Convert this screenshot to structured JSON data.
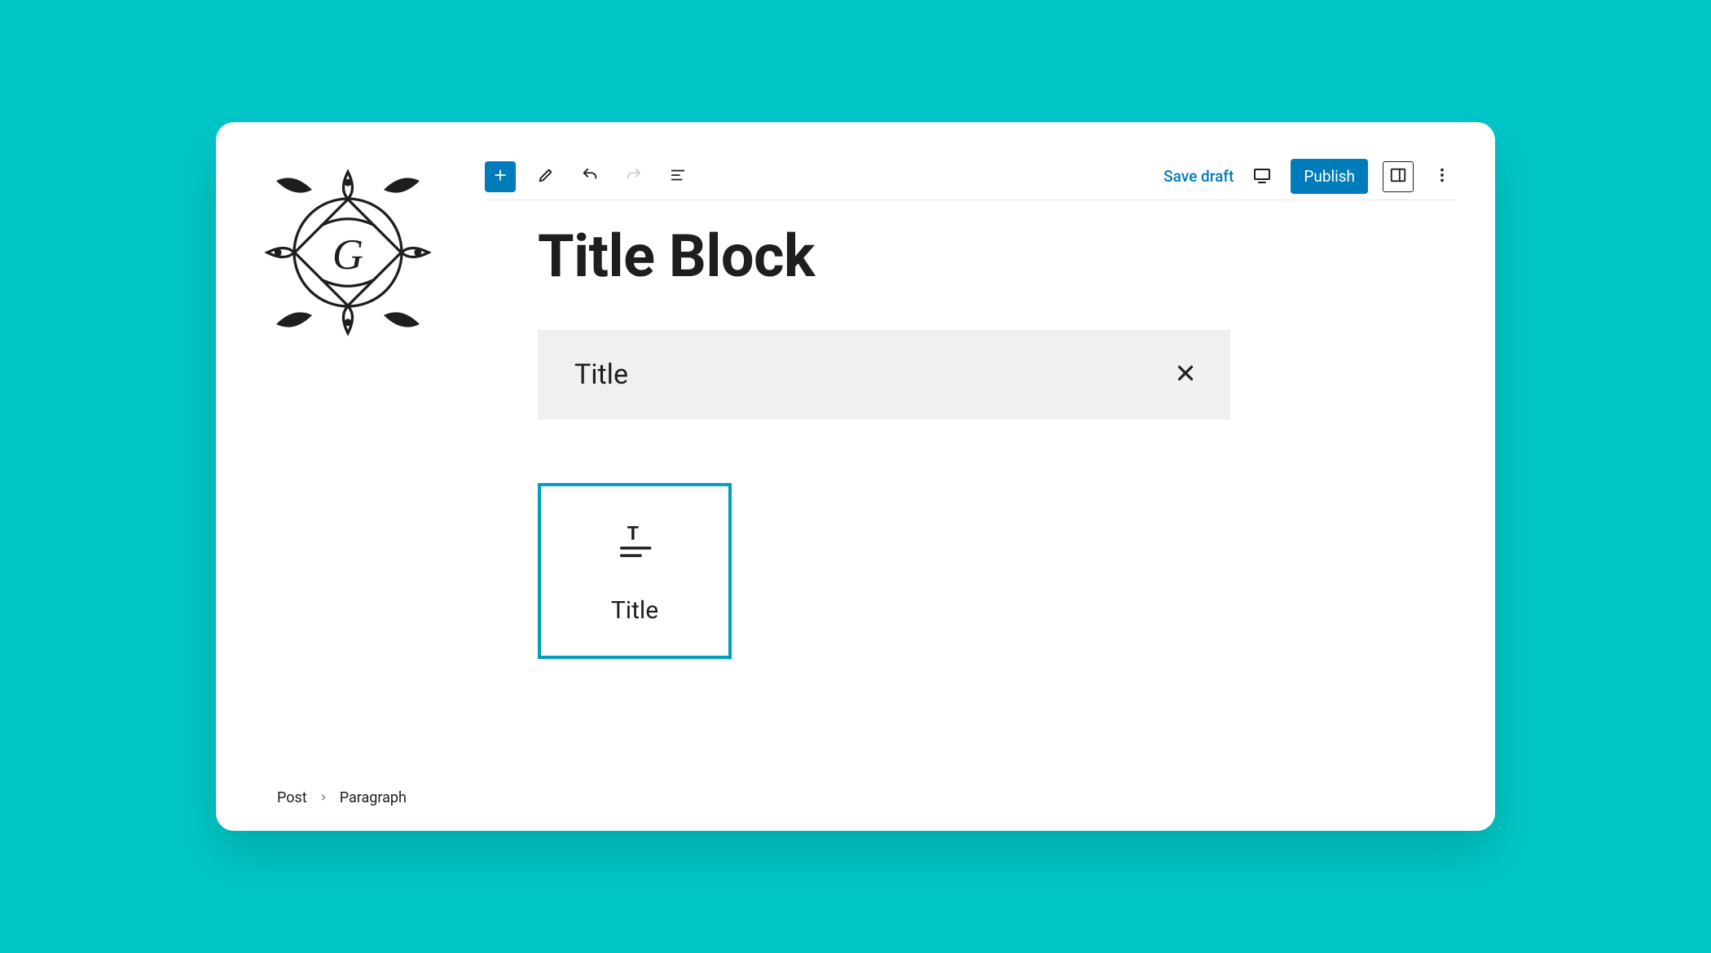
{
  "toolbar": {
    "save_draft_label": "Save draft",
    "publish_label": "Publish"
  },
  "page": {
    "title": "Title Block"
  },
  "search": {
    "value": "Title"
  },
  "result": {
    "label": "Title"
  },
  "breadcrumb": {
    "root": "Post",
    "leaf": "Paragraph"
  }
}
